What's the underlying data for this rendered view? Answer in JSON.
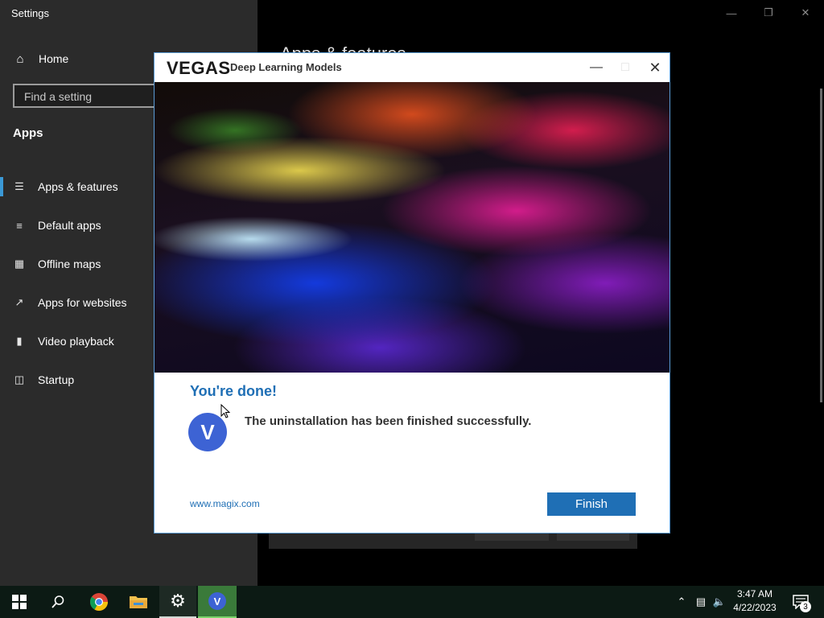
{
  "settings": {
    "title": "Settings",
    "home_label": "Home",
    "search_placeholder": "Find a setting",
    "section_title": "Apps",
    "background_heading": "Apps & features",
    "nav_items": [
      {
        "label": "Apps & features",
        "icon": "list-icon",
        "active": true
      },
      {
        "label": "Default apps",
        "icon": "default-apps-icon",
        "active": false
      },
      {
        "label": "Offline maps",
        "icon": "map-icon",
        "active": false
      },
      {
        "label": "Apps for websites",
        "icon": "open-external-icon",
        "active": false
      },
      {
        "label": "Video playback",
        "icon": "video-icon",
        "active": false
      },
      {
        "label": "Startup",
        "icon": "startup-icon",
        "active": false
      }
    ]
  },
  "dialog": {
    "logo": "VEGAS",
    "app_title": "Deep Learning Models",
    "done_title": "You're done!",
    "avatar_letter": "V",
    "message": "The uninstallation has been finished successfully.",
    "link": "www.magix.com",
    "finish_label": "Finish"
  },
  "taskbar": {
    "time": "3:47 AM",
    "date": "4/22/2023",
    "notification_count": "3",
    "vegas_letter": "V"
  },
  "colors": {
    "accent": "#1f6fb5",
    "nav_active": "#3b99d6",
    "avatar": "#3d63d4"
  }
}
